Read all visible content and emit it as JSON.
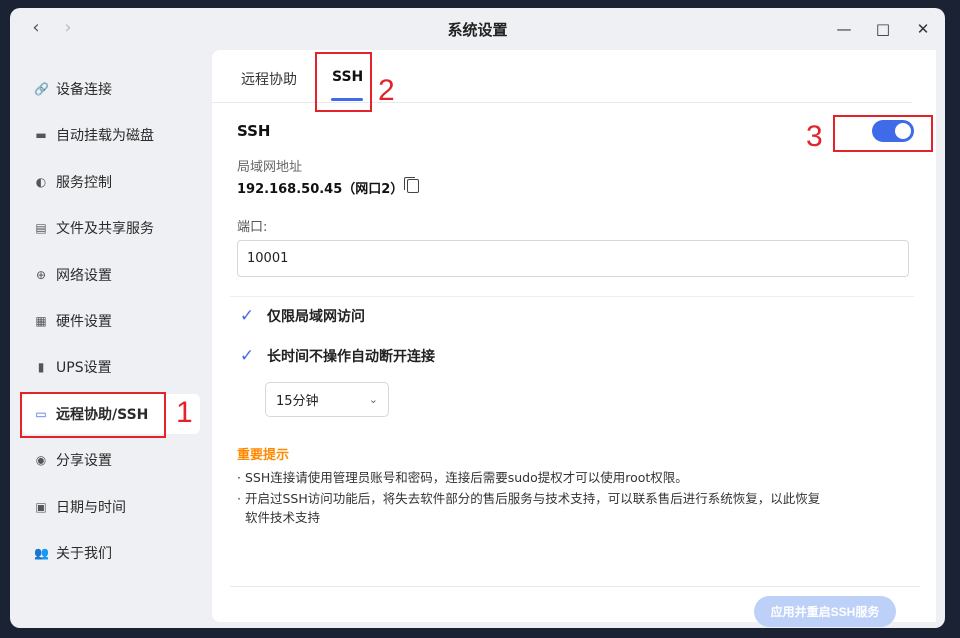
{
  "window": {
    "title": "系统设置",
    "back_icon": "‹",
    "forward_icon": "›",
    "minimize_icon": "—",
    "maximize_icon": "□",
    "close_icon": "✕"
  },
  "sidebar": {
    "items": [
      {
        "label": "设备连接",
        "icon": "link-icon",
        "glyph": "🔗"
      },
      {
        "label": "自动挂载为磁盘",
        "icon": "drive-icon",
        "glyph": "▬"
      },
      {
        "label": "服务控制",
        "icon": "toggle-icon",
        "glyph": "◐"
      },
      {
        "label": "文件及共享服务",
        "icon": "file-share-icon",
        "glyph": "▤"
      },
      {
        "label": "网络设置",
        "icon": "globe-icon",
        "glyph": "⊕"
      },
      {
        "label": "硬件设置",
        "icon": "grid-icon",
        "glyph": "▦"
      },
      {
        "label": "UPS设置",
        "icon": "ups-icon",
        "glyph": "▮"
      },
      {
        "label": "远程协助/SSH",
        "icon": "remote-icon",
        "glyph": "▭"
      },
      {
        "label": "分享设置",
        "icon": "share-icon",
        "glyph": "◉"
      },
      {
        "label": "日期与时间",
        "icon": "calendar-icon",
        "glyph": "▣"
      },
      {
        "label": "关于我们",
        "icon": "users-icon",
        "glyph": "👥"
      }
    ],
    "active_index": 7
  },
  "tabs": [
    {
      "label": "远程协助"
    },
    {
      "label": "SSH"
    }
  ],
  "ssh": {
    "section_title": "SSH",
    "enabled": true,
    "lan_label": "局域网地址",
    "lan_address": "192.168.50.45（网口2）",
    "port_label": "端口:",
    "port_value": "10001",
    "lan_only_label": "仅限局域网访问",
    "auto_disconnect_label": "长时间不操作自动断开连接",
    "timeout_value": "15分钟",
    "check_glyph": "✓",
    "chevron_glyph": "⌄"
  },
  "notice": {
    "title": "重要提示",
    "line1": "· SSH连接请使用管理员账号和密码，连接后需要sudo提权才可以使用root权限。",
    "line2": "· 开启过SSH访问功能后，将失去软件部分的售后服务与技术支持，可以联系售后进行系统恢复，以此恢复",
    "line3": "  软件技术支持"
  },
  "footer": {
    "apply_label": "应用并重启SSH服务"
  },
  "annotations": {
    "n1": "1",
    "n2": "2",
    "n3": "3",
    "color": "#e2232b"
  },
  "colors": {
    "accent": "#3f6be8",
    "warning": "#ff8a00",
    "disabled_button": "#bcd0f8"
  }
}
